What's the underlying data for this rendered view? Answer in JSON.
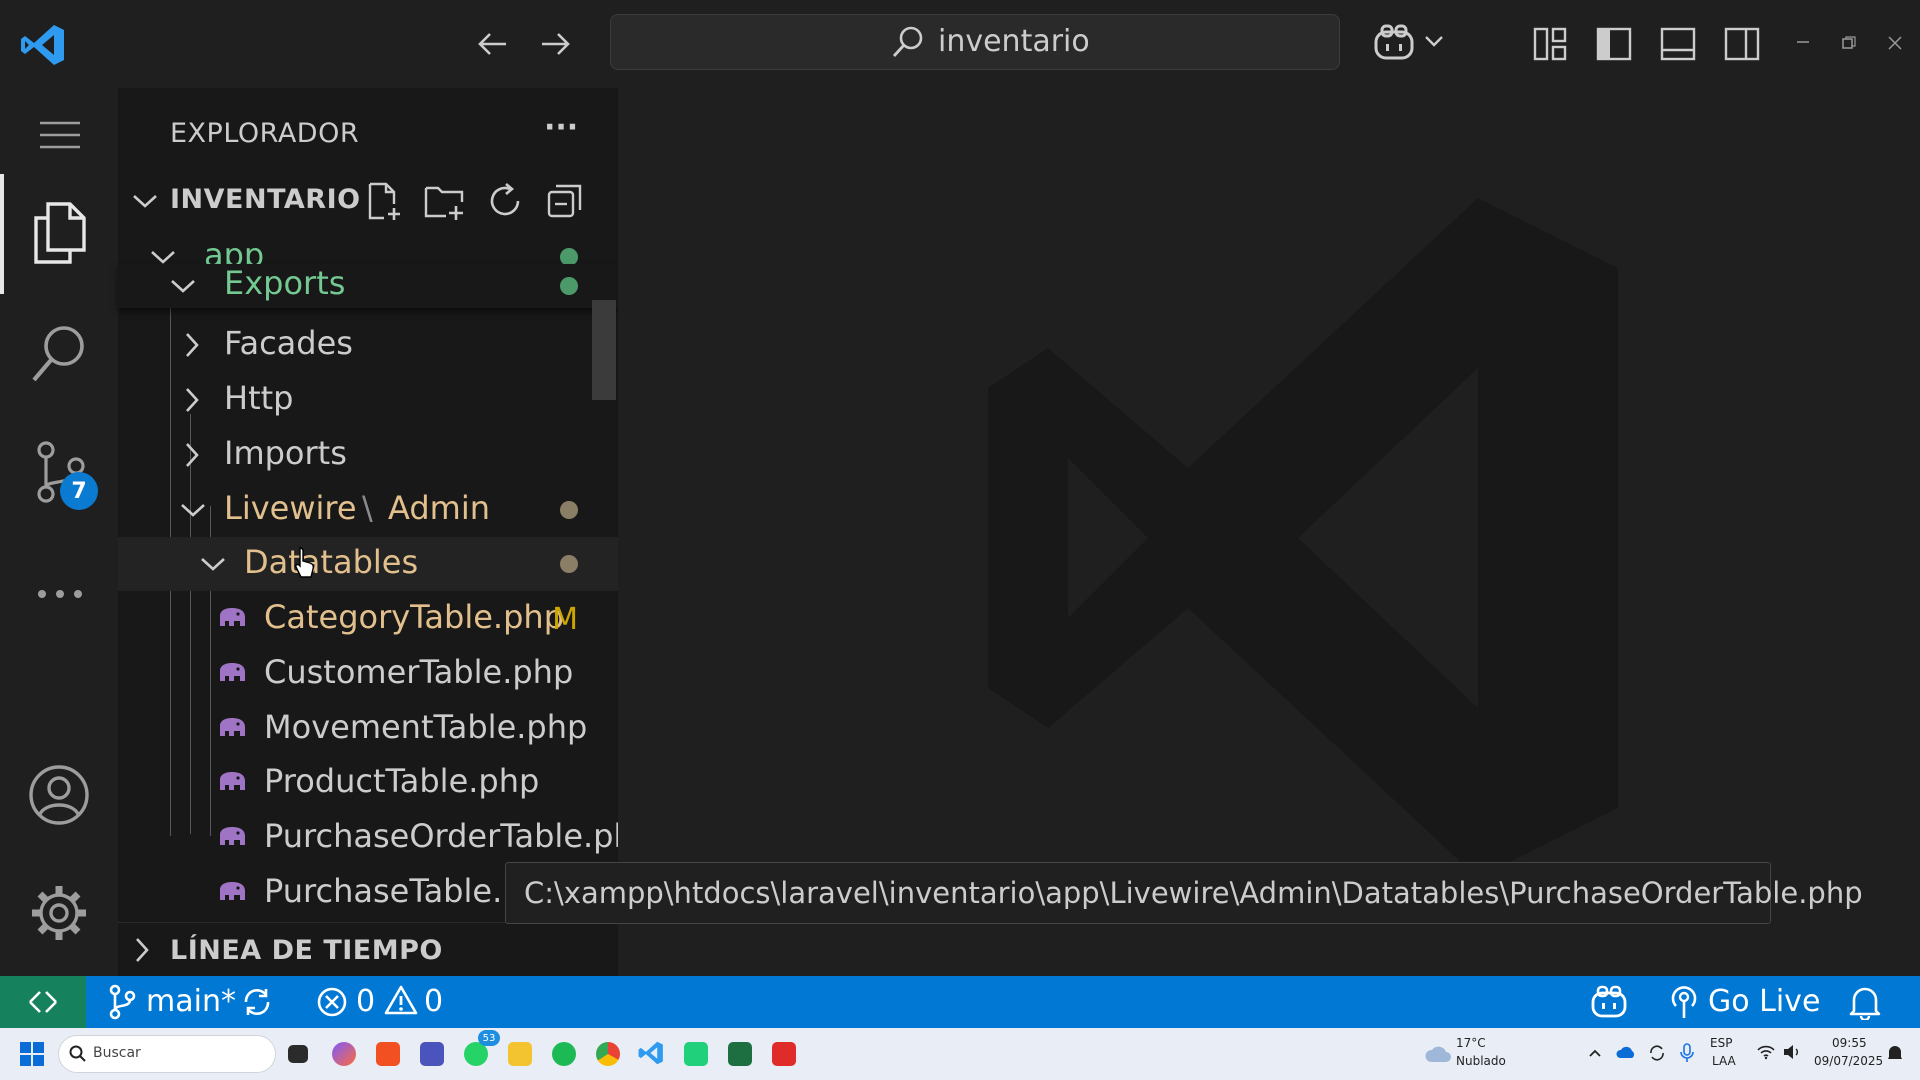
{
  "title_bar": {
    "search_text": "inventario"
  },
  "activity_bar": {
    "scm_badge": "7"
  },
  "explorer": {
    "header": "EXPLORADOR",
    "more_label": "···",
    "root_title": "INVENTARIO",
    "tree": {
      "app": "app",
      "exports": "Exports",
      "facades": "Facades",
      "http": "Http",
      "imports": "Imports",
      "livewire": "Livewire",
      "path_sep": "\\",
      "admin": "Admin",
      "datatables": "Datatables"
    },
    "files": [
      {
        "name": "CategoryTable.php",
        "status": "M"
      },
      {
        "name": "CustomerTable.php",
        "status": ""
      },
      {
        "name": "MovementTable.php",
        "status": ""
      },
      {
        "name": "ProductTable.php",
        "status": ""
      },
      {
        "name": "PurchaseOrderTable.php",
        "status": ""
      },
      {
        "name": "PurchaseTable.ph",
        "status": ""
      }
    ],
    "timeline": "LÍNEA DE TIEMPO"
  },
  "tooltip": {
    "path": "C:\\xampp\\htdocs\\laravel\\inventario\\app\\Livewire\\Admin\\Datatables\\PurchaseOrderTable.php"
  },
  "status_bar": {
    "branch": "main*",
    "errors": "0",
    "warnings": "0",
    "go_live": "Go Live"
  },
  "taskbar": {
    "search_placeholder": "Buscar",
    "whatsapp_badge": "53",
    "weather_temp": "17°C",
    "weather_desc": "Nublado",
    "lang_top": "ESP",
    "lang_bottom": "LAA",
    "time": "09:55",
    "date": "09/07/2025"
  },
  "colors": {
    "accent_blue": "#0078d4",
    "remote_green": "#16825d",
    "git_added": "#73c991",
    "git_modified": "#e2c08d",
    "php_icon": "#a074c4"
  }
}
